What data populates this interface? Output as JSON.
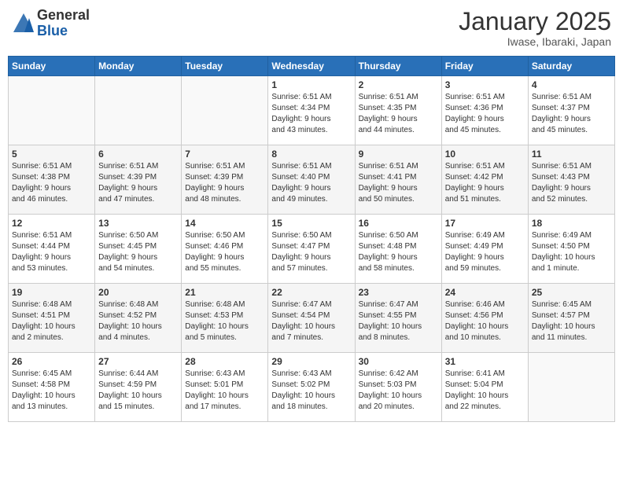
{
  "header": {
    "logo_general": "General",
    "logo_blue": "Blue",
    "month_title": "January 2025",
    "location": "Iwase, Ibaraki, Japan"
  },
  "days_of_week": [
    "Sunday",
    "Monday",
    "Tuesday",
    "Wednesday",
    "Thursday",
    "Friday",
    "Saturday"
  ],
  "weeks": [
    [
      {
        "day": "",
        "info": ""
      },
      {
        "day": "",
        "info": ""
      },
      {
        "day": "",
        "info": ""
      },
      {
        "day": "1",
        "info": "Sunrise: 6:51 AM\nSunset: 4:34 PM\nDaylight: 9 hours\nand 43 minutes."
      },
      {
        "day": "2",
        "info": "Sunrise: 6:51 AM\nSunset: 4:35 PM\nDaylight: 9 hours\nand 44 minutes."
      },
      {
        "day": "3",
        "info": "Sunrise: 6:51 AM\nSunset: 4:36 PM\nDaylight: 9 hours\nand 45 minutes."
      },
      {
        "day": "4",
        "info": "Sunrise: 6:51 AM\nSunset: 4:37 PM\nDaylight: 9 hours\nand 45 minutes."
      }
    ],
    [
      {
        "day": "5",
        "info": "Sunrise: 6:51 AM\nSunset: 4:38 PM\nDaylight: 9 hours\nand 46 minutes."
      },
      {
        "day": "6",
        "info": "Sunrise: 6:51 AM\nSunset: 4:39 PM\nDaylight: 9 hours\nand 47 minutes."
      },
      {
        "day": "7",
        "info": "Sunrise: 6:51 AM\nSunset: 4:39 PM\nDaylight: 9 hours\nand 48 minutes."
      },
      {
        "day": "8",
        "info": "Sunrise: 6:51 AM\nSunset: 4:40 PM\nDaylight: 9 hours\nand 49 minutes."
      },
      {
        "day": "9",
        "info": "Sunrise: 6:51 AM\nSunset: 4:41 PM\nDaylight: 9 hours\nand 50 minutes."
      },
      {
        "day": "10",
        "info": "Sunrise: 6:51 AM\nSunset: 4:42 PM\nDaylight: 9 hours\nand 51 minutes."
      },
      {
        "day": "11",
        "info": "Sunrise: 6:51 AM\nSunset: 4:43 PM\nDaylight: 9 hours\nand 52 minutes."
      }
    ],
    [
      {
        "day": "12",
        "info": "Sunrise: 6:51 AM\nSunset: 4:44 PM\nDaylight: 9 hours\nand 53 minutes."
      },
      {
        "day": "13",
        "info": "Sunrise: 6:50 AM\nSunset: 4:45 PM\nDaylight: 9 hours\nand 54 minutes."
      },
      {
        "day": "14",
        "info": "Sunrise: 6:50 AM\nSunset: 4:46 PM\nDaylight: 9 hours\nand 55 minutes."
      },
      {
        "day": "15",
        "info": "Sunrise: 6:50 AM\nSunset: 4:47 PM\nDaylight: 9 hours\nand 57 minutes."
      },
      {
        "day": "16",
        "info": "Sunrise: 6:50 AM\nSunset: 4:48 PM\nDaylight: 9 hours\nand 58 minutes."
      },
      {
        "day": "17",
        "info": "Sunrise: 6:49 AM\nSunset: 4:49 PM\nDaylight: 9 hours\nand 59 minutes."
      },
      {
        "day": "18",
        "info": "Sunrise: 6:49 AM\nSunset: 4:50 PM\nDaylight: 10 hours\nand 1 minute."
      }
    ],
    [
      {
        "day": "19",
        "info": "Sunrise: 6:48 AM\nSunset: 4:51 PM\nDaylight: 10 hours\nand 2 minutes."
      },
      {
        "day": "20",
        "info": "Sunrise: 6:48 AM\nSunset: 4:52 PM\nDaylight: 10 hours\nand 4 minutes."
      },
      {
        "day": "21",
        "info": "Sunrise: 6:48 AM\nSunset: 4:53 PM\nDaylight: 10 hours\nand 5 minutes."
      },
      {
        "day": "22",
        "info": "Sunrise: 6:47 AM\nSunset: 4:54 PM\nDaylight: 10 hours\nand 7 minutes."
      },
      {
        "day": "23",
        "info": "Sunrise: 6:47 AM\nSunset: 4:55 PM\nDaylight: 10 hours\nand 8 minutes."
      },
      {
        "day": "24",
        "info": "Sunrise: 6:46 AM\nSunset: 4:56 PM\nDaylight: 10 hours\nand 10 minutes."
      },
      {
        "day": "25",
        "info": "Sunrise: 6:45 AM\nSunset: 4:57 PM\nDaylight: 10 hours\nand 11 minutes."
      }
    ],
    [
      {
        "day": "26",
        "info": "Sunrise: 6:45 AM\nSunset: 4:58 PM\nDaylight: 10 hours\nand 13 minutes."
      },
      {
        "day": "27",
        "info": "Sunrise: 6:44 AM\nSunset: 4:59 PM\nDaylight: 10 hours\nand 15 minutes."
      },
      {
        "day": "28",
        "info": "Sunrise: 6:43 AM\nSunset: 5:01 PM\nDaylight: 10 hours\nand 17 minutes."
      },
      {
        "day": "29",
        "info": "Sunrise: 6:43 AM\nSunset: 5:02 PM\nDaylight: 10 hours\nand 18 minutes."
      },
      {
        "day": "30",
        "info": "Sunrise: 6:42 AM\nSunset: 5:03 PM\nDaylight: 10 hours\nand 20 minutes."
      },
      {
        "day": "31",
        "info": "Sunrise: 6:41 AM\nSunset: 5:04 PM\nDaylight: 10 hours\nand 22 minutes."
      },
      {
        "day": "",
        "info": ""
      }
    ]
  ]
}
